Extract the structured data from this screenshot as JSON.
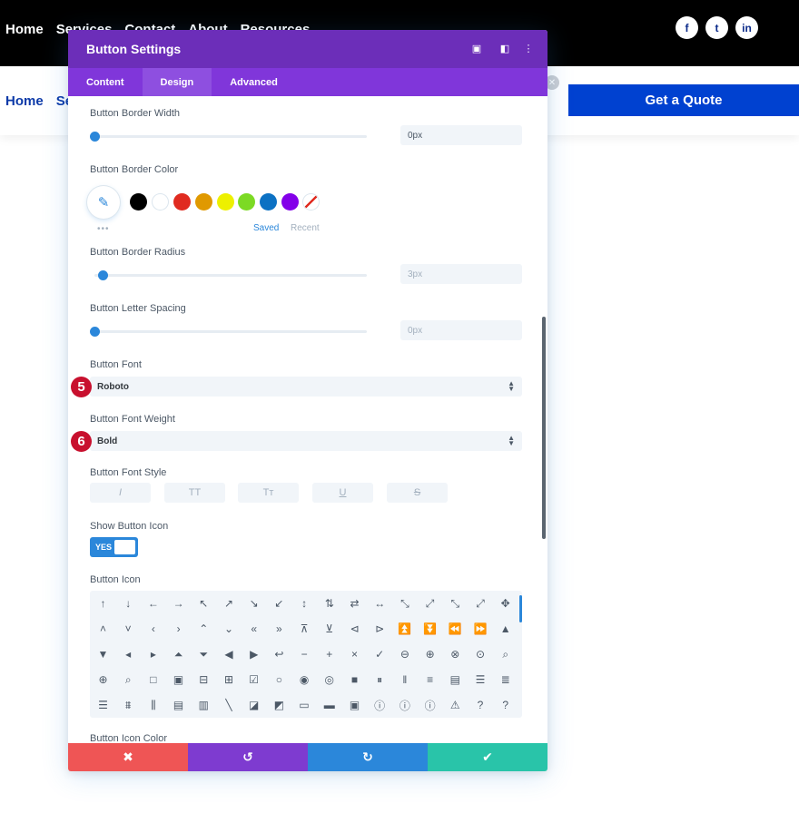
{
  "site": {
    "top_nav": [
      "Home",
      "Services",
      "Contact",
      "About",
      "Resources"
    ],
    "second_nav": [
      "Home",
      "Se"
    ],
    "social_icons": [
      "facebook-icon",
      "twitter-icon",
      "linkedin-icon"
    ],
    "social_glyphs": [
      "f",
      "t",
      "in"
    ],
    "quote_button": "Get a Quote",
    "close_glyph": "✕"
  },
  "modal": {
    "title": "Button Settings",
    "header_icons": [
      "expand-icon",
      "columns-icon",
      "more-icon"
    ],
    "header_glyphs": [
      "▣",
      "◧",
      "⋮"
    ],
    "tabs": [
      "Content",
      "Design",
      "Advanced"
    ],
    "active_tab": "Design",
    "border_width": {
      "label": "Button Border Width",
      "value": "0px",
      "level": 0
    },
    "border_color": {
      "label": "Button Border Color",
      "swatches": [
        "#000000",
        "#ffffff",
        "#e02b20",
        "#e09900",
        "#edf000",
        "#7cda24",
        "#0c71c3",
        "#8300e9"
      ],
      "saved": "Saved",
      "recent": "Recent",
      "more": "•••"
    },
    "border_radius": {
      "label": "Button Border Radius",
      "value": "3px",
      "level": 0.03
    },
    "letter_spacing": {
      "label": "Button Letter Spacing",
      "value": "0px",
      "level": 0
    },
    "font": {
      "label": "Button Font",
      "value": "Roboto",
      "badge": "5"
    },
    "font_weight": {
      "label": "Button Font Weight",
      "value": "Bold",
      "badge": "6"
    },
    "font_style": {
      "label": "Button Font Style",
      "options": [
        "I",
        "TT",
        "Tт",
        "U",
        "S"
      ]
    },
    "show_icon": {
      "label": "Show Button Icon",
      "value": "YES"
    },
    "icon": {
      "label": "Button Icon",
      "rows": [
        [
          "↑",
          "↓",
          "←",
          "→",
          "↖",
          "↗",
          "↘",
          "↙",
          "↕",
          "⇅",
          "⇄",
          "↔",
          "⤡",
          "⤢",
          "⤡",
          "⤢",
          "✥"
        ],
        [
          "˄",
          "˅",
          "‹",
          "›",
          "⌃",
          "⌄",
          "«",
          "»",
          "⊼",
          "⊻",
          "⊲",
          "⊳",
          "⏫",
          "⏬",
          "⏪",
          "⏩",
          "▲"
        ],
        [
          "▼",
          "◂",
          "▸",
          "⏶",
          "⏷",
          "◀",
          "▶",
          "↩",
          "−",
          "+",
          "×",
          "✓",
          "⊖",
          "⊕",
          "⊗",
          "⊙",
          "⌕"
        ],
        [
          "⊕",
          "⌕",
          "□",
          "▣",
          "⊟",
          "⊞",
          "☑",
          "○",
          "◉",
          "◎",
          "■",
          "⏸",
          "‖",
          "≡",
          "▤",
          "☰",
          "≣"
        ],
        [
          "☰",
          "⩩",
          "⫼",
          "▤",
          "▥",
          "╲",
          "◪",
          "◩",
          "▭",
          "▬",
          "▣",
          "ⓘ",
          "ⓘ",
          "ⓘ",
          "⚠",
          "?",
          "?"
        ]
      ]
    },
    "icon_color_label": "Button Icon Color",
    "footer": [
      "✖",
      "↺",
      "↻",
      "✔"
    ]
  }
}
